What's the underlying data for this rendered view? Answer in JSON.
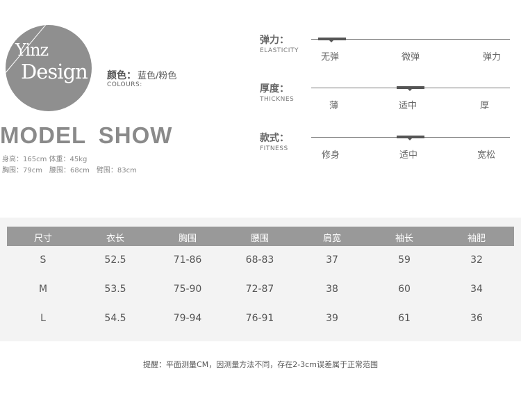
{
  "logo": {
    "line1": "Yinz",
    "line2": "Design"
  },
  "colour": {
    "label_cn": "颜色：",
    "value": "蓝色/粉色",
    "label_en": "COLOURS:"
  },
  "model": {
    "title": "MODEL SHOW",
    "line1": "身高：165cm 体重：45kg",
    "line2": "胸围：79cm　腰围：68cm　臂围：83cm"
  },
  "scales": [
    {
      "label_cn": "弹力：",
      "label_en": "ELASTICITY",
      "options": [
        "无弹",
        "微弹",
        "弹力"
      ],
      "selected_position": 0.05
    },
    {
      "label_cn": "厚度：",
      "label_en": "THICKNES",
      "options": [
        "薄",
        "适中",
        "厚"
      ],
      "selected_position": 0.5
    },
    {
      "label_cn": "款式：",
      "label_en": "FITNESS",
      "options": [
        "修身",
        "适中",
        "宽松"
      ],
      "selected_position": 0.5
    }
  ],
  "size_table": {
    "headers": [
      "尺寸",
      "衣长",
      "胸围",
      "腰围",
      "肩宽",
      "袖长",
      "袖肥"
    ],
    "rows": [
      [
        "S",
        "52.5",
        "71-86",
        "68-83",
        "37",
        "59",
        "32"
      ],
      [
        "M",
        "53.5",
        "75-90",
        "72-87",
        "38",
        "60",
        "34"
      ],
      [
        "L",
        "54.5",
        "79-94",
        "76-91",
        "39",
        "61",
        "36"
      ]
    ]
  },
  "note": "提醒：平面测量CM，因测量方法不同，存在2-3cm误差属于正常范围"
}
